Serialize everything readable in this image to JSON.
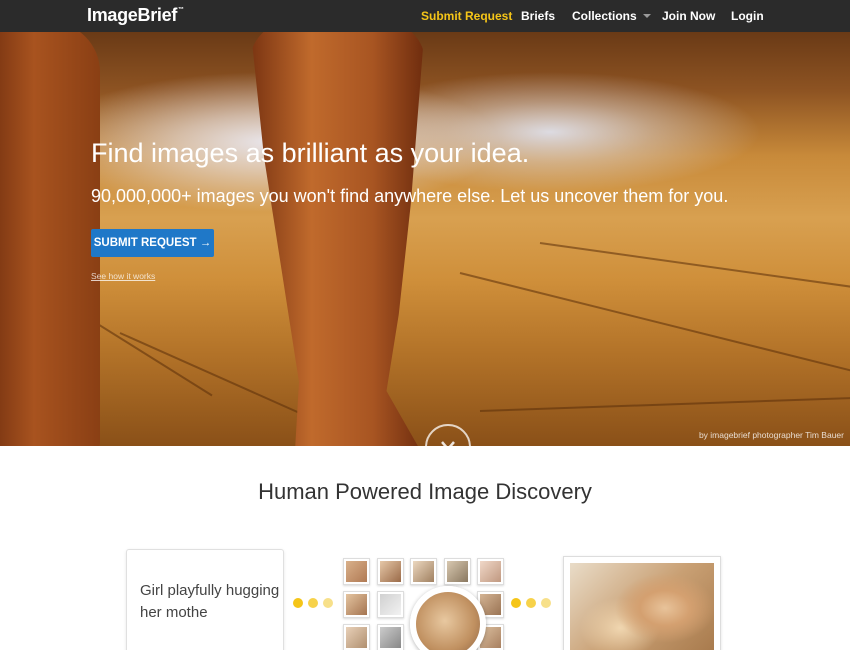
{
  "nav": {
    "logo": "ImageBrief",
    "logo_mark": "™",
    "items": [
      {
        "label": "Submit Request",
        "accent": true
      },
      {
        "label": "Briefs"
      },
      {
        "label": "Collections",
        "has_dropdown": true
      },
      {
        "label": "Join Now"
      },
      {
        "label": "Login"
      }
    ]
  },
  "hero": {
    "title": "Find images as brilliant as your idea.",
    "subtitle": "90,000,000+ images you won't find anywhere else. Let us uncover them for you.",
    "cta_label": "SUBMIT REQUEST →",
    "how_link": "See how it works",
    "credit": "by imagebrief photographer Tim Bauer",
    "scroll_icon": "chevron-down-icon"
  },
  "discovery": {
    "title": "Human Powered Image Discovery",
    "query_text": "Girl playfully hugging her mothe"
  },
  "colors": {
    "nav_bg": "#2b2b2b",
    "accent": "#f5c518",
    "cta_bg": "#1f78c8",
    "dot_active": "#f5c518",
    "dot_inactive": "#f7e08a"
  }
}
